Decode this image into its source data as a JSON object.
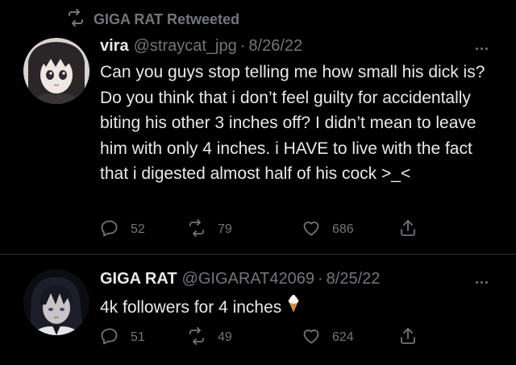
{
  "retweet_context": {
    "label": "GIGA RAT Retweeted"
  },
  "tweets": [
    {
      "display_name": "vira",
      "handle": "@straycat_jpg",
      "separator": "·",
      "date": "8/26/22",
      "text": "Can you guys stop telling me how small his dick is? Do you think that i don’t feel guilty for accidentally biting his other 3 inches off? I didn’t mean to leave him with only 4 inches. i HAVE to live with the fact that i digested almost half of his cock >_<",
      "replies": "52",
      "retweets": "79",
      "likes": "686"
    },
    {
      "display_name": "GIGA RAT",
      "handle": "@GIGARAT42069",
      "separator": "·",
      "date": "8/25/22",
      "text": "4k followers for 4 inches",
      "emoji": "ice-cream-icon",
      "replies": "51",
      "retweets": "49",
      "likes": "624"
    }
  ],
  "colors": {
    "background": "#000000",
    "primary_text": "#e7e9ea",
    "secondary_text": "#71767b",
    "divider": "#2f3336"
  }
}
